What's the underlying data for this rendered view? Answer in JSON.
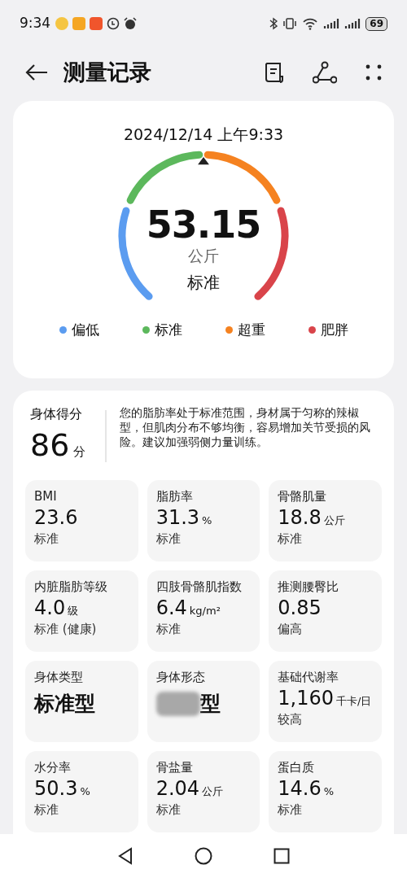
{
  "status_bar": {
    "time": "9:34",
    "battery": "69"
  },
  "header": {
    "title": "测量记录"
  },
  "summary": {
    "datetime": "2024/12/14 上午9:33",
    "weight": "53.15",
    "unit": "公斤",
    "rating": "标准",
    "legend": [
      {
        "label": "偏低",
        "color": "#5b9cf0"
      },
      {
        "label": "标准",
        "color": "#5cb85c"
      },
      {
        "label": "超重",
        "color": "#f58220"
      },
      {
        "label": "肥胖",
        "color": "#d9444a"
      }
    ]
  },
  "score": {
    "label": "身体得分",
    "value": "86",
    "unit": "分",
    "comment": "您的脂肪率处于标准范围，身材属于匀称的辣椒型，但肌肉分布不够均衡，容易增加关节受损的风险。建议加强弱侧力量训练。"
  },
  "metrics": [
    {
      "label": "BMI",
      "value": "23.6",
      "rating": "标准"
    },
    {
      "label": "脂肪率",
      "value": "31.3",
      "unit": "%",
      "rating": "标准"
    },
    {
      "label": "骨骼肌量",
      "value": "18.8",
      "unit": "公斤",
      "rating": "标准"
    },
    {
      "label": "内脏脂肪等级",
      "value": "4.0",
      "unit": "级",
      "rating": "标准 (健康)"
    },
    {
      "label": "四肢骨骼肌指数",
      "value": "6.4",
      "unit": "kg/m²",
      "rating": "标准"
    },
    {
      "label": "推测腰臀比",
      "value": "0.85",
      "rating": "偏高"
    },
    {
      "kind": "type",
      "label": "身体类型",
      "value": "标准型"
    },
    {
      "kind": "type",
      "label": "身体形态",
      "value": "型",
      "blurred": true
    },
    {
      "label": "基础代谢率",
      "value": "1,160",
      "unit": "千卡/日",
      "rating": "较高"
    },
    {
      "label": "水分率",
      "value": "50.3",
      "unit": "%",
      "rating": "标准"
    },
    {
      "label": "骨盐量",
      "value": "2.04",
      "unit": "公斤",
      "rating": "标准"
    },
    {
      "label": "蛋白质",
      "value": "14.6",
      "unit": "%",
      "rating": "标准"
    }
  ]
}
